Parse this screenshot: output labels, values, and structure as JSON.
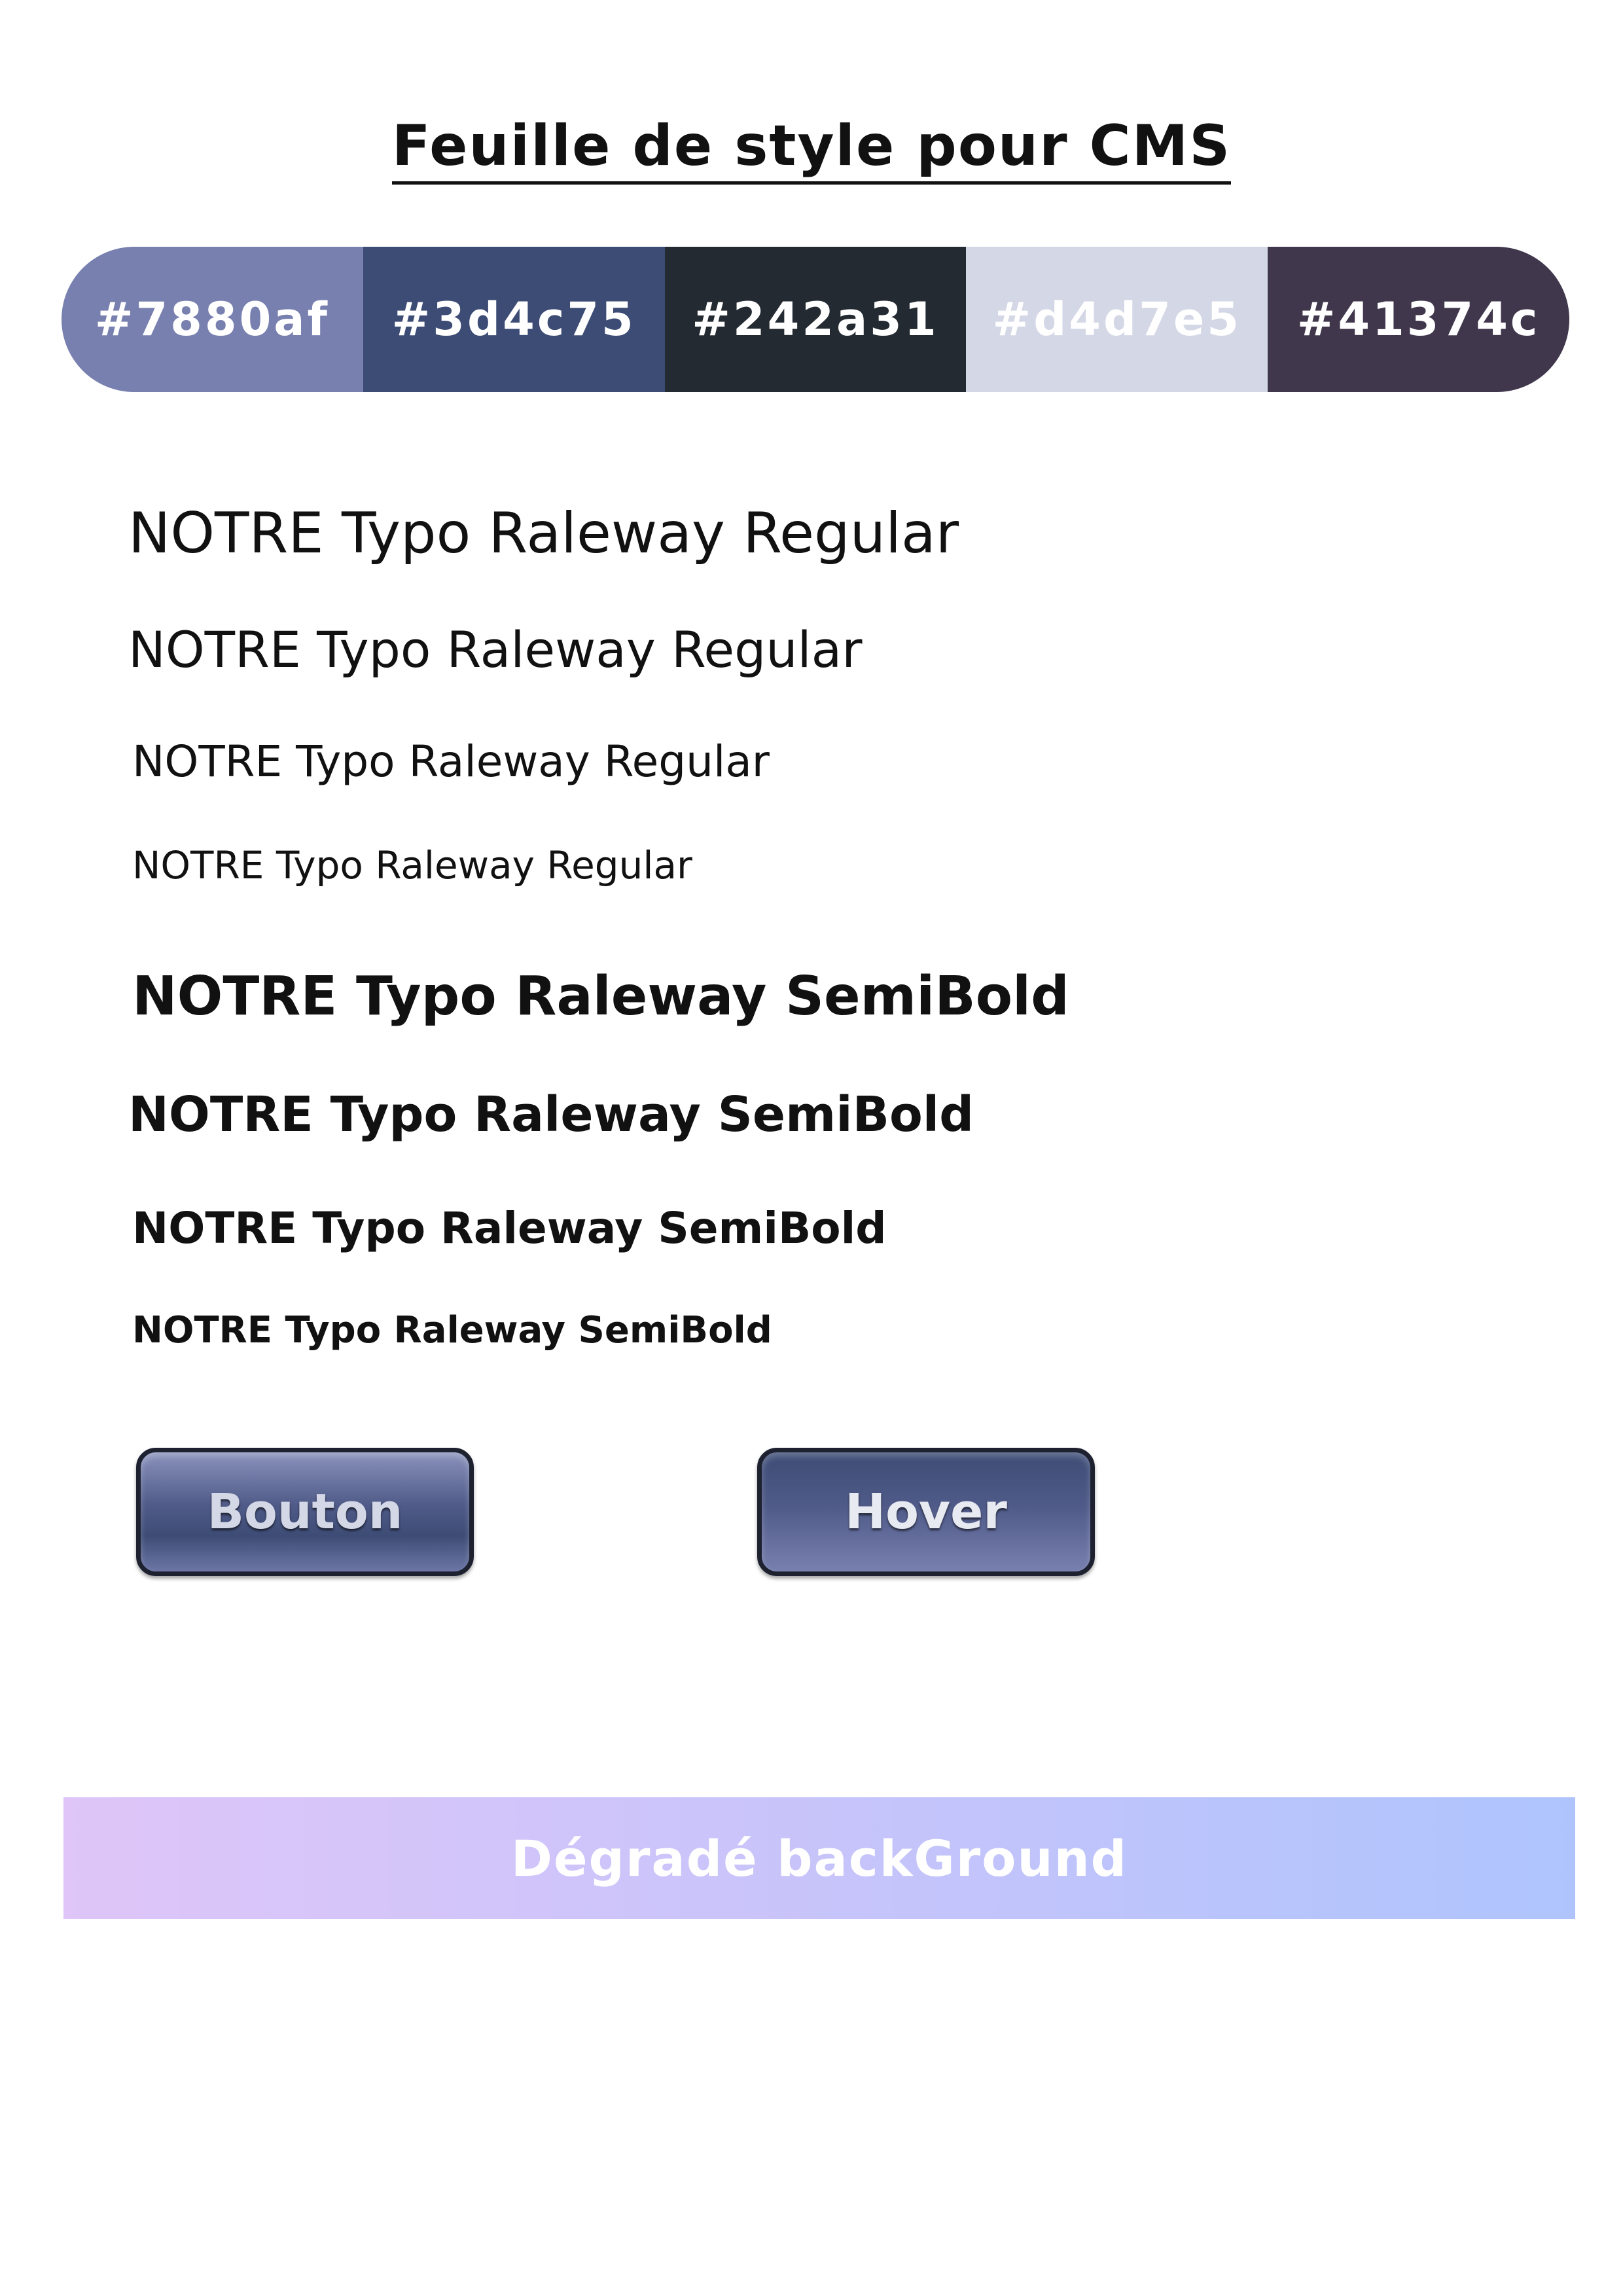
{
  "document": {
    "title": "Feuille de style pour CMS"
  },
  "palette": {
    "swatches": [
      {
        "label": "#7880af",
        "color": "#7880af",
        "text_color": "#ffffff"
      },
      {
        "label": "#3d4c75",
        "color": "#3d4c75",
        "text_color": "#ffffff"
      },
      {
        "label": "#242a31",
        "color": "#242a31",
        "text_color": "#ffffff"
      },
      {
        "label": "#d4d7e5",
        "color": "#d4d7e5",
        "text_color": "#ffffff"
      },
      {
        "label": "#41374c",
        "color": "#41374c",
        "text_color": "#ffffff"
      }
    ]
  },
  "typography": {
    "regular": [
      "NOTRE Typo Raleway Regular",
      "NOTRE Typo Raleway Regular",
      "NOTRE Typo Raleway Regular",
      "NOTRE Typo Raleway Regular"
    ],
    "semibold": [
      "NOTRE Typo Raleway SemiBold",
      "NOTRE Typo Raleway SemiBold",
      "NOTRE Typo Raleway SemiBold",
      "NOTRE Typo Raleway SemiBold"
    ]
  },
  "buttons": {
    "primary_label": "Bouton",
    "hover_label": "Hover"
  },
  "gradient": {
    "label": "Dégradé backGround",
    "start_color": "#dfc5f8",
    "end_color": "#afc4fd"
  }
}
